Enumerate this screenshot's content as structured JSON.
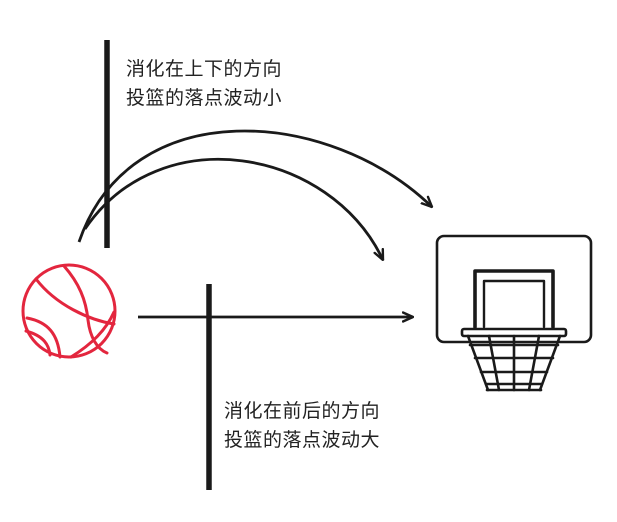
{
  "colors": {
    "ink": "#1a1a1a",
    "text": "#222222",
    "ball": "#e3263e",
    "background": "#ffffff"
  },
  "captions": {
    "vertical": {
      "line1": "消化在上下的方向",
      "line2": "投篮的落点波动小"
    },
    "horizontal": {
      "line1": "消化在前后的方向",
      "line2": "投篮的落点波动大"
    }
  },
  "icons": {
    "ball": "basketball-icon",
    "hoop": "basketball-hoop-icon"
  }
}
